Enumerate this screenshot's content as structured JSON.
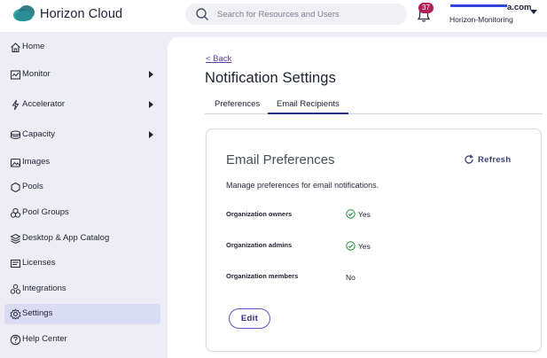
{
  "header": {
    "brand": "Horizon Cloud",
    "search_placeholder": "Search for Resources and Users",
    "notification_count": "37",
    "account_domain": "a.com",
    "account_org": "Horizon-Monitoring"
  },
  "sidebar": {
    "items": [
      {
        "label": "Home",
        "icon": "home-icon"
      },
      {
        "label": "Monitor",
        "icon": "monitor-icon",
        "expandable": true
      },
      {
        "label": "Accelerator",
        "icon": "accelerator-icon",
        "expandable": true
      },
      {
        "label": "Capacity",
        "icon": "capacity-icon",
        "expandable": true
      },
      {
        "label": "Images",
        "icon": "images-icon"
      },
      {
        "label": "Pools",
        "icon": "pools-icon"
      },
      {
        "label": "Pool Groups",
        "icon": "pool-groups-icon"
      },
      {
        "label": "Desktop & App Catalog",
        "icon": "catalog-icon"
      },
      {
        "label": "Licenses",
        "icon": "licenses-icon"
      },
      {
        "label": "Integrations",
        "icon": "integrations-icon"
      },
      {
        "label": "Settings",
        "icon": "settings-icon",
        "active": true
      },
      {
        "label": "Help Center",
        "icon": "help-icon"
      }
    ]
  },
  "main": {
    "back_label": "< Back",
    "title": "Notification Settings",
    "tabs": [
      {
        "label": "Preferences"
      },
      {
        "label": "Email Recipients",
        "active": true
      }
    ],
    "card": {
      "title": "Email Preferences",
      "refresh_label": "Refresh",
      "description": "Manage preferences for email notifications.",
      "rows": [
        {
          "label": "Organization owners",
          "value": "Yes",
          "checked": true
        },
        {
          "label": "Organization admins",
          "value": "Yes",
          "checked": true
        },
        {
          "label": "Organization members",
          "value": "No",
          "checked": false
        }
      ],
      "edit_label": "Edit"
    }
  },
  "colors": {
    "accent": "#5a3fb1",
    "active_nav": "#d9dcf4",
    "check": "#1f8a3a",
    "badge": "#b01e56"
  }
}
